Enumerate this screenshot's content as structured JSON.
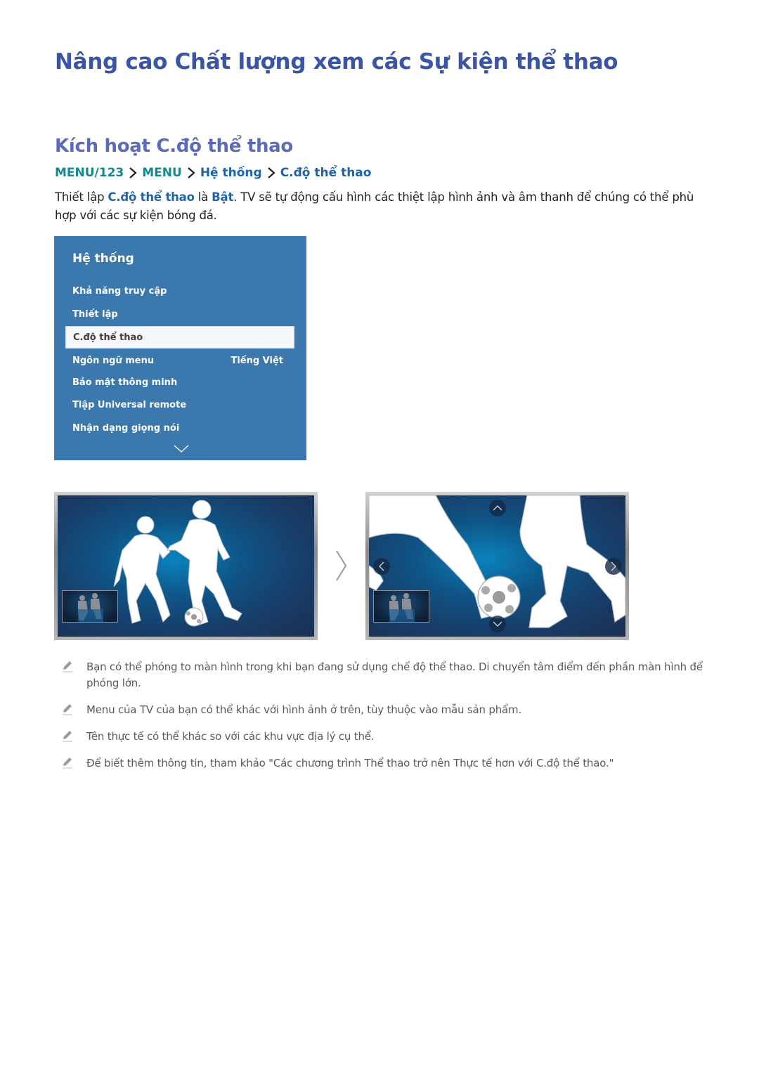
{
  "title": "Nâng cao Chất lượng xem các Sự kiện thể thao",
  "section_title": "Kích hoạt C.độ thể thao",
  "breadcrumb": {
    "items": [
      "MENU/123",
      "MENU",
      "Hệ thống",
      "C.độ thể thao"
    ],
    "separator_icon": "chevron-right-icon"
  },
  "intro": {
    "part1": "Thiết lập ",
    "bold1": "C.độ thể thao",
    "part2": " là ",
    "bold2": "Bật",
    "part3": ". TV sẽ tự động cấu hình các thiệt lập hình ảnh và âm thanh để chúng có thể phù hợp với các sự kiện bóng đá."
  },
  "tv_menu": {
    "title": "Hệ thống",
    "items": [
      {
        "label": "Khả năng truy cập",
        "value": ""
      },
      {
        "label": "Thiết lập",
        "value": ""
      },
      {
        "label": "C.độ thể thao",
        "value": "",
        "selected": true
      },
      {
        "label": "Ngôn ngữ menu",
        "value": "Tiếng Việt"
      },
      {
        "label": "Bảo mật thông minh",
        "value": ""
      },
      {
        "label": "Tlập Universal remote",
        "value": ""
      },
      {
        "label": "Nhận dạng giọng nói",
        "value": ""
      }
    ],
    "more_icon": "chevron-down-icon",
    "colors": {
      "background": "#3a78ad",
      "selected_bg": "#f4f7fb"
    }
  },
  "illustrations": {
    "before": "football-players-normal-view",
    "after": "football-players-zoomed-view",
    "transition_icon": "chevron-right-icon",
    "zoom_nav_icons": [
      "chevron-up-icon",
      "chevron-left-icon",
      "chevron-right-icon",
      "chevron-down-icon"
    ]
  },
  "notes": [
    "Bạn có thể phóng to màn hình trong khi bạn đang sử dụng chế độ thể thao. Di chuyển tâm điểm đến phần màn hình để phóng lớn.",
    "Menu của TV của bạn có thể khác với hình ảnh ở trên, tùy thuộc vào mẫu sản phẩm.",
    "Tên thực tế có thể khác so với các khu vực địa lý cụ thể.",
    "Để biết thêm thông tin, tham khảo \"Các chương trình Thể thao trở nên Thực tế hơn với C.độ thể thao.\""
  ],
  "note_icon": "pencil-icon"
}
